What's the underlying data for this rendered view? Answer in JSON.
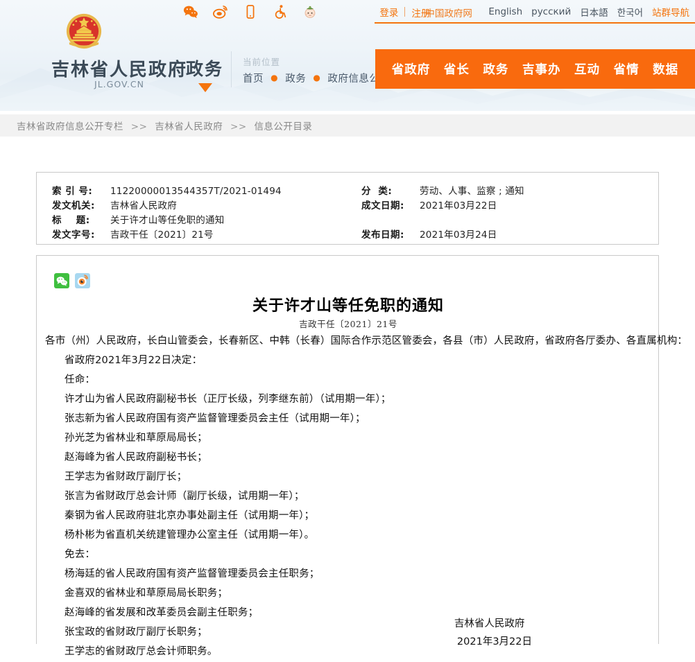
{
  "header": {
    "emblem_alt": "national-emblem",
    "site_name": "吉林省人民政府",
    "site_domain": "JL.GOV.CN",
    "channel": "政务",
    "current_position_label": "当前位置",
    "top_breadcrumb": [
      "首页",
      "政务",
      "政府信息公开"
    ],
    "social_icons": [
      "wechat-icon",
      "weibo-icon",
      "mobile-icon",
      "accessibility-icon",
      "child-mode-icon"
    ],
    "utility": {
      "login": "登录",
      "register": "注册",
      "gov_portal": "中国政府网",
      "english": "English",
      "russian": "русский",
      "japanese": "日本語",
      "korean": "한국어",
      "site_group": "站群导航"
    },
    "mainnav": [
      "省政府",
      "省长",
      "政务",
      "吉事办",
      "互动",
      "省情",
      "数据"
    ],
    "accent_color": "#f96a0e"
  },
  "breadcrumb": {
    "items": [
      "吉林省政府信息公开专栏",
      "吉林省人民政府",
      "信息公开目录"
    ],
    "separator": ">>"
  },
  "meta": {
    "left": [
      {
        "key": "索 引 号:",
        "value": "11220000013544357T/2021-01494"
      },
      {
        "key": "发文机关:",
        "value": "吉林省人民政府"
      },
      {
        "key": "标    题:",
        "value": "关于许才山等任免职的通知"
      },
      {
        "key": "发文字号:",
        "value": "吉政干任〔2021〕21号"
      }
    ],
    "right": [
      {
        "key": "分  类:",
        "value": "劳动、人事、监察 ; 通知"
      },
      {
        "key": "成文日期:",
        "value": "2021年03月22日"
      },
      {
        "key": "",
        "value": ""
      },
      {
        "key": "发布日期:",
        "value": "2021年03月24日"
      }
    ]
  },
  "article": {
    "share_icons": [
      "wechat-share-icon",
      "weibo-share-icon"
    ],
    "title": "关于许才山等任免职的通知",
    "doc_number": "吉政干任〔2021〕21号",
    "paragraphs": [
      {
        "text": "各市（州）人民政府，长白山管委会，长春新区、中韩（长春）国际合作示范区管委会，各县（市）人民政府，省政府各厅委办、各直属机构：",
        "indent": false
      },
      {
        "text": "省政府2021年3月22日决定：",
        "indent": true
      },
      {
        "text": "任命：",
        "indent": true
      },
      {
        "text": "许才山为省人民政府副秘书长（正厅长级，列李继东前）（试用期一年）；",
        "indent": true
      },
      {
        "text": "张志新为省人民政府国有资产监督管理委员会主任（试用期一年）；",
        "indent": true
      },
      {
        "text": "孙光芝为省林业和草原局局长；",
        "indent": true
      },
      {
        "text": "赵海峰为省人民政府副秘书长；",
        "indent": true
      },
      {
        "text": "王学志为省财政厅副厅长；",
        "indent": true
      },
      {
        "text": "张言为省财政厅总会计师（副厅长级，试用期一年）；",
        "indent": true
      },
      {
        "text": "秦钢为省人民政府驻北京办事处副主任（试用期一年）；",
        "indent": true
      },
      {
        "text": "杨朴彬为省直机关统建管理办公室主任（试用期一年）。",
        "indent": true
      },
      {
        "text": "免去：",
        "indent": true
      },
      {
        "text": "杨海廷的省人民政府国有资产监督管理委员会主任职务；",
        "indent": true
      },
      {
        "text": "金喜双的省林业和草原局局长职务；",
        "indent": true
      },
      {
        "text": "赵海峰的省发展和改革委员会副主任职务；",
        "indent": true
      },
      {
        "text": "张宝政的省财政厅副厅长职务；",
        "indent": true
      },
      {
        "text": "王学志的省财政厅总会计师职务。",
        "indent": true
      }
    ],
    "signature_org": "吉林省人民政府",
    "signature_date": "2021年3月22日"
  }
}
